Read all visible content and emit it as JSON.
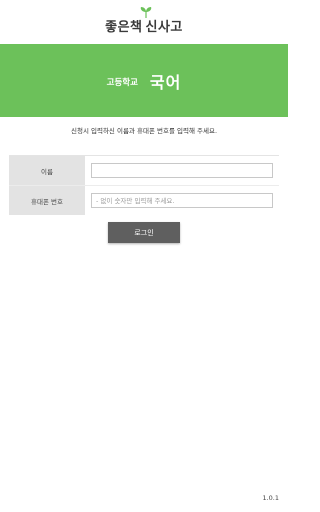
{
  "header": {
    "logo_main": "좋은책",
    "logo_sub": "신사고",
    "logo_leaf_color": "#6cc15a"
  },
  "hero": {
    "level": "고등학교",
    "subject": "국어",
    "background_color": "#6cc15a"
  },
  "instruction": "신청시 입력하신 이름과 휴대폰 번호를 입력해 주세요.",
  "form": {
    "name_label": "이름",
    "name_value": "",
    "phone_label": "휴대폰 번호",
    "phone_placeholder": "- 없이 숫자만 입력해 주세요."
  },
  "login_button": {
    "label": "로그인",
    "color": "#5f5f5f"
  },
  "version": "1.0.1"
}
